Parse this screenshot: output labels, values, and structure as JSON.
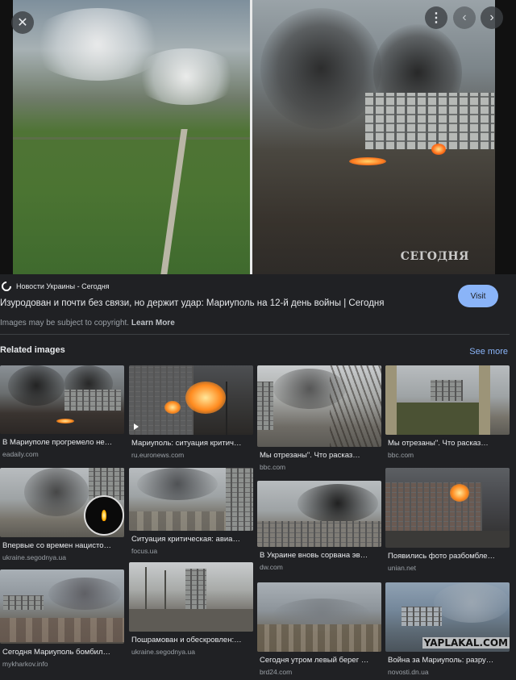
{
  "viewer": {
    "close_icon": "close-icon",
    "more_icon": "more-vert-icon",
    "prev_icon": "chevron-left-icon",
    "next_icon": "chevron-right-icon",
    "watermark": "СЕГОДНЯ"
  },
  "result": {
    "source": "Новости Украины - Сегодня",
    "title": "Изуродован и почти без связи, но держит удар: Мариуполь на 12-й день войны | Сегодня",
    "visit_label": "Visit",
    "copyright_text": "Images may be subject to copyright.",
    "learn_more": "Learn More"
  },
  "related": {
    "heading": "Related images",
    "see_more": "See more",
    "columns": [
      [
        {
          "caption": "В Мариуполе прогремело не…",
          "domain": "eadaily.com"
        },
        {
          "caption": "Впервые со времен нацисто…",
          "domain": "ukraine.segodnya.ua"
        },
        {
          "caption": "Сегодня Мариуполь бомбил…",
          "domain": "mykharkov.info"
        }
      ],
      [
        {
          "caption": "Мариуполь: ситуация критич…",
          "domain": "ru.euronews.com"
        },
        {
          "caption": "Ситуация критическая: авиа…",
          "domain": "focus.ua"
        },
        {
          "caption": "Пошрамован и обескровлен:…",
          "domain": "ukraine.segodnya.ua"
        }
      ],
      [
        {
          "caption": "Мы отрезаны\". Что расказ…",
          "domain": "bbc.com"
        },
        {
          "caption": "В Украине вновь сорвана эв…",
          "domain": "dw.com"
        },
        {
          "caption": "Сегодня утром левый берег …",
          "domain": "brd24.com"
        }
      ],
      [
        {
          "caption": "Мы отрезаны\". Что расказ…",
          "domain": "bbc.com"
        },
        {
          "caption": "Появились фото разбомбле…",
          "domain": "unian.net"
        },
        {
          "caption": "Война за Мариуполь: разру…",
          "domain": "novosti.dn.ua"
        }
      ]
    ],
    "yaplakal_watermark": "YAPLAKAL.COM"
  },
  "colors": {
    "background": "#202124",
    "accent": "#8ab4f8",
    "text": "#e8eaed",
    "muted": "#9aa0a6"
  }
}
